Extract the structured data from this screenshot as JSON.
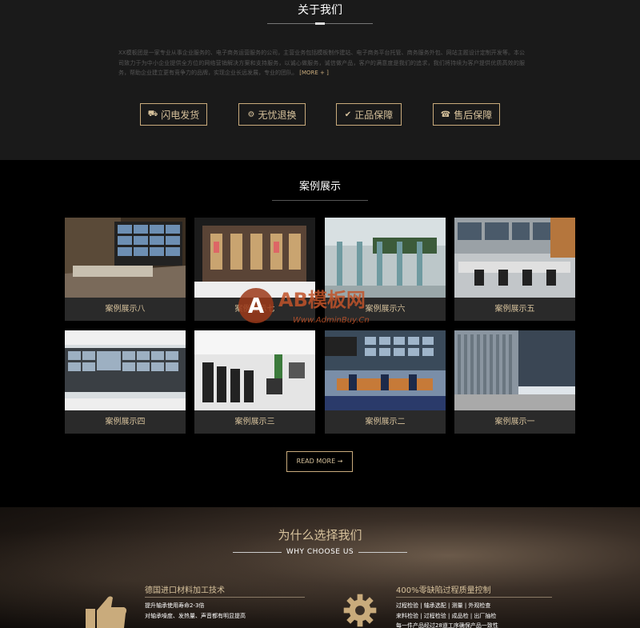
{
  "about": {
    "title": "关于我们",
    "description": "XX模板团是一家专业从事企业服务的、电子商务运营服务的公司，主营业务包括模板制作建站、电子商务平台托管、商务服务外包、网站主题设计定制开发等。本公司致力于为中小企业提供全方位的网络营销解决方案和支持服务，以诚心做服务，诚信做产品，客户的满意度是我们的追求，我们将持续为客户提供优质高效的服务，帮助企业建立更有竞争力的品牌，实现企业长远发展，专业的团队。",
    "more": "[MORE + ]",
    "features": [
      {
        "icon": "truck-icon",
        "glyph": "⛟",
        "label": "闪电发货"
      },
      {
        "icon": "gears-icon",
        "glyph": "⚙",
        "label": "无忧退换"
      },
      {
        "icon": "check-circle-icon",
        "glyph": "✔",
        "label": "正品保障"
      },
      {
        "icon": "service-icon",
        "glyph": "☎",
        "label": "售后保障"
      }
    ]
  },
  "cases": {
    "title": "案例展示",
    "items": [
      {
        "caption": "案例展示八",
        "theme": "control-room"
      },
      {
        "caption": "案例展示七",
        "theme": "store"
      },
      {
        "caption": "案例展示六",
        "theme": "gate"
      },
      {
        "caption": "案例展示五",
        "theme": "monitor-room"
      },
      {
        "caption": "案例展示四",
        "theme": "video-wall"
      },
      {
        "caption": "案例展示三",
        "theme": "meeting"
      },
      {
        "caption": "案例展示二",
        "theme": "operators"
      },
      {
        "caption": "案例展示一",
        "theme": "building"
      }
    ],
    "readmore": "READ MORE →"
  },
  "watermark": {
    "letter": "A",
    "brand": "AB模板网",
    "url": "Www.AdminBuy.Cn"
  },
  "why": {
    "title": "为什么选择我们",
    "subtitle": "WHY CHOOSE US",
    "left": {
      "heading": "德国进口材料加工技术",
      "lines": [
        "提升轴承使用寿命2-3倍",
        "对轴承噪度、发热量、声音都有明显提高"
      ]
    },
    "right": {
      "heading": "400%零缺陷过程质量控制",
      "lines": [
        "过程检验 | 轴承选配 | 测量 | 外观检查",
        "来料检验 | 过程检验 | 成品检 | 出厂抽检",
        "每一件产品经过28道工序确保产品一致性"
      ]
    }
  },
  "colors": {
    "accent": "#c9ab7c",
    "about_bg": "#1a1a1a",
    "cases_bg": "#000000",
    "card_bg": "#2a2a2a"
  }
}
